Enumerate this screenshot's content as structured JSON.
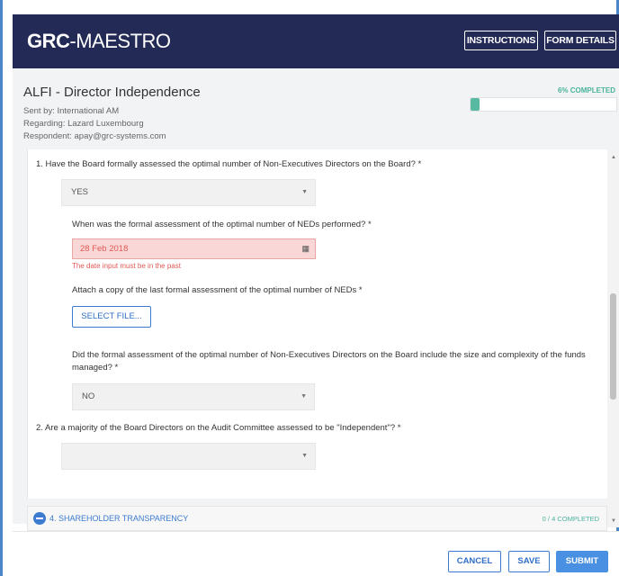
{
  "header": {
    "logo_bold": "GRC",
    "logo_dash": "-",
    "logo_light": "MAESTRO",
    "instructions_label": "INSTRUCTIONS",
    "form_details_label": "FORM DETAILS"
  },
  "form": {
    "title": "ALFI - Director Independence",
    "sent_by": "Sent by: International AM",
    "regarding": "Regarding: Lazard Luxembourg",
    "respondent": "Respondent: apay@grc-systems.com",
    "progress_label": "6% COMPLETED",
    "progress_fraction": 0.06
  },
  "questions": {
    "q1": {
      "text": "1.  Have the Board formally assessed the optimal number of Non-Executives Directors on the Board? *",
      "answer": "YES",
      "date_question": "When was the formal assessment of the optimal number of NEDs performed? *",
      "date_value": "28 Feb 2018",
      "date_error": "The date input must be in the past",
      "attach_question": "Attach a copy of the last formal assessment of the optimal number of NEDs *",
      "select_file_label": "SELECT FILE...",
      "size_question": "Did the formal assessment of the optimal number of Non-Executives Directors on the Board include the size and complexity of the funds managed? *",
      "size_answer": "NO"
    },
    "q2": {
      "text": "2.  Are a majority of the Board Directors on the Audit Committee assessed to be \"Independent\"? *",
      "answer": ""
    }
  },
  "section": {
    "title": "4. SHAREHOLDER TRANSPARENCY",
    "status": "0 / 4 COMPLETED",
    "icon": "minus-circle-icon"
  },
  "footer": {
    "cancel_label": "CANCEL",
    "save_label": "SAVE",
    "submit_label": "SUBMIT"
  },
  "colors": {
    "header_bg": "#232a55",
    "accent": "#3b7bd0",
    "progress": "#56b9a0",
    "error": "#e15a55"
  }
}
